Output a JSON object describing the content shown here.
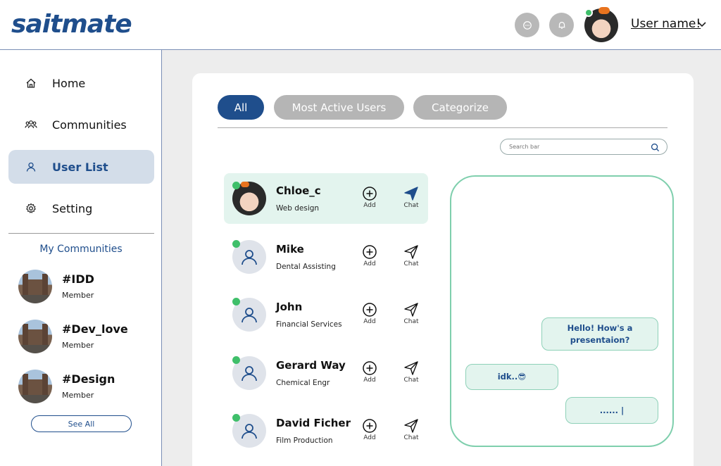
{
  "app": {
    "logo": "saitmate"
  },
  "header": {
    "username": "User name!"
  },
  "sidebar": {
    "nav": [
      {
        "label": "Home",
        "icon": "home-icon"
      },
      {
        "label": "Communities",
        "icon": "communities-icon"
      },
      {
        "label": "User List",
        "icon": "user-icon",
        "active": true
      },
      {
        "label": "Setting",
        "icon": "gear-icon"
      }
    ],
    "my_communities_title": "My Communities",
    "communities": [
      {
        "name": "#IDD",
        "role": "Member"
      },
      {
        "name": "#Dev_love",
        "role": "Member"
      },
      {
        "name": "#Design",
        "role": "Member"
      }
    ],
    "see_all": "See All"
  },
  "main": {
    "tabs": [
      {
        "label": "All",
        "active": true
      },
      {
        "label": "Most Active Users",
        "active": false
      },
      {
        "label": "Categorize",
        "active": false
      }
    ],
    "search_placeholder": "Search bar",
    "users": [
      {
        "name": "Chloe_c",
        "role": "Web design",
        "online": true,
        "active": true
      },
      {
        "name": "Mike",
        "role": "Dental Assisting",
        "online": true
      },
      {
        "name": "John",
        "role": "Financial Services",
        "online": true
      },
      {
        "name": "Gerard Way",
        "role": "Chemical Engr",
        "online": true
      },
      {
        "name": "David Ficher",
        "role": "Film Production",
        "online": true
      }
    ],
    "add_label": "Add",
    "chat_label": "Chat"
  },
  "chat": {
    "messages": [
      {
        "text": "Hello! How's a presentaion?",
        "side": "right"
      },
      {
        "text": "idk..😎",
        "side": "left"
      },
      {
        "text": "...... |",
        "side": "right"
      }
    ]
  },
  "colors": {
    "brand": "#1f4e8c",
    "accent_green": "#7fcfad",
    "online": "#3fbf6a",
    "inactive_tab": "#b5b5b5"
  }
}
